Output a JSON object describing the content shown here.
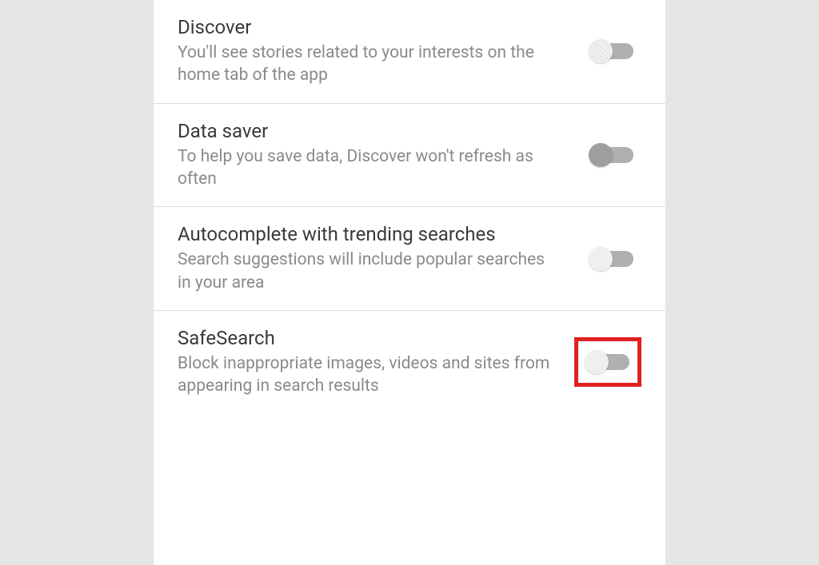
{
  "settings": [
    {
      "title": "Discover",
      "description": "You'll see stories related to your interests on the home tab of the app",
      "enabled": false,
      "thumb_style": "hatched",
      "highlighted": false
    },
    {
      "title": "Data saver",
      "description": "To help you save data, Discover won't refresh as often",
      "enabled": true,
      "thumb_style": "dark",
      "highlighted": false
    },
    {
      "title": "Autocomplete with trending searches",
      "description": "Search suggestions will include popular searches in your area",
      "enabled": false,
      "thumb_style": "light",
      "highlighted": false
    },
    {
      "title": "SafeSearch",
      "description": "Block inappropriate images, videos and sites from appearing in search results",
      "enabled": false,
      "thumb_style": "light",
      "highlighted": true
    }
  ]
}
